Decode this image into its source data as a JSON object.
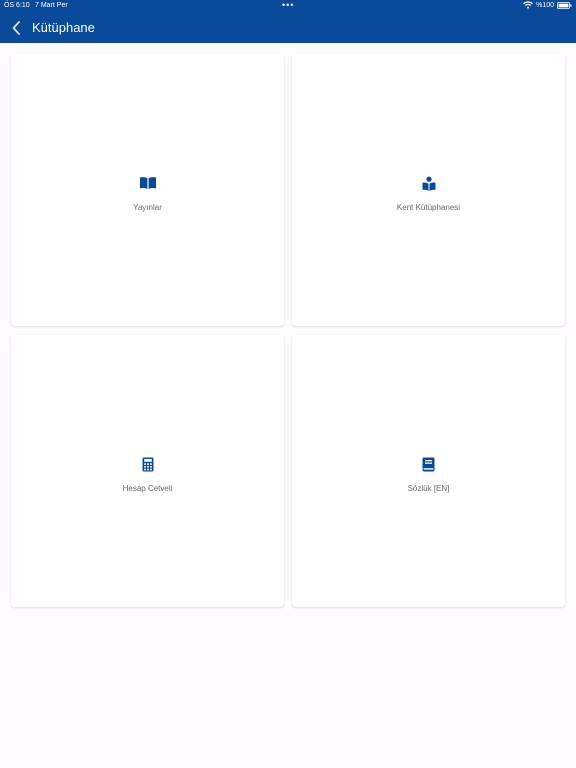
{
  "status_bar": {
    "time": "ÖS 6:10",
    "date": "7 Mart Per",
    "dots": "•••",
    "battery": "%100"
  },
  "nav": {
    "title": "Kütüphane",
    "back_icon": "chevron-left-icon"
  },
  "tiles": [
    {
      "label": "Yayınlar",
      "icon": "book-open-icon"
    },
    {
      "label": "Kent Kütüphanesi",
      "icon": "book-reader-icon"
    },
    {
      "label": "Hesap Cetveli",
      "icon": "calculator-icon"
    },
    {
      "label": "Sözlük [EN]",
      "icon": "book-icon"
    }
  ],
  "colors": {
    "header": "#0a4a9b",
    "icon": "#0a4a9b",
    "background": "#fdfbfd",
    "label": "#666666"
  }
}
